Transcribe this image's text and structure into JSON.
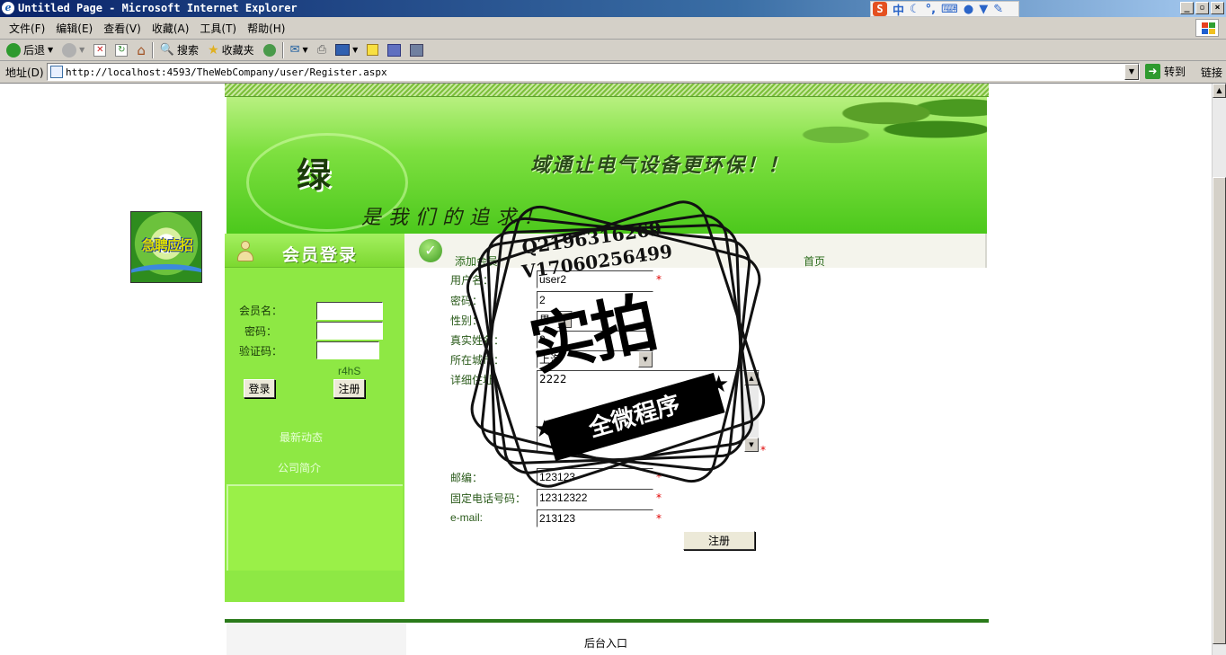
{
  "browser": {
    "title": "Untitled Page - Microsoft Internet Explorer",
    "ime_label": "中",
    "menu": [
      "文件(F)",
      "编辑(E)",
      "查看(V)",
      "收藏(A)",
      "工具(T)",
      "帮助(H)"
    ],
    "toolbar": {
      "back": "后退",
      "search": "搜索",
      "favorites": "收藏夹"
    },
    "address_label": "地址(D)",
    "url": "http://localhost:4593/TheWebCompany/user/Register.aspx",
    "go_label": "转到",
    "links_label": "链接"
  },
  "ad": {
    "text": "急聘应招"
  },
  "banner": {
    "logo_char": "绿",
    "slogan1": "域通让电气设备更环保！！",
    "slogan2": "是我们的追求！"
  },
  "login": {
    "title": "会员登录",
    "member_label": "会员名：",
    "password_label": "密码：",
    "captcha_label": "验证码：",
    "captcha_value": "r4hS",
    "login_button": "登录",
    "register_button": "注册"
  },
  "sidebar": {
    "news": "最新动态",
    "about": "公司简介"
  },
  "nav": {
    "add_member": "添加会员",
    "home": "首页"
  },
  "form": {
    "username_label": "用户名：",
    "username_value": "user2",
    "password_label": "密码：",
    "password_value": "2",
    "gender_label": "性别：",
    "gender_value": "男",
    "realname_label": "真实姓名：",
    "realname_value": "2",
    "city_label": "所在城市：",
    "city_value": "上海",
    "address_label": "详细住址：",
    "address_value": "2222",
    "zip_label": "邮编：",
    "zip_value": "123123",
    "phone_label": "固定电话号码：",
    "phone_value": "12312322",
    "email_label": "e-mail:",
    "email_value": "213123",
    "required_mark": "*",
    "submit_label": "注册"
  },
  "footer": {
    "admin_link": "后台入口"
  },
  "watermark": {
    "qq": "Q2196316269",
    "wx": "V17060256499",
    "big": "实拍",
    "ribbon": "全微程序"
  }
}
